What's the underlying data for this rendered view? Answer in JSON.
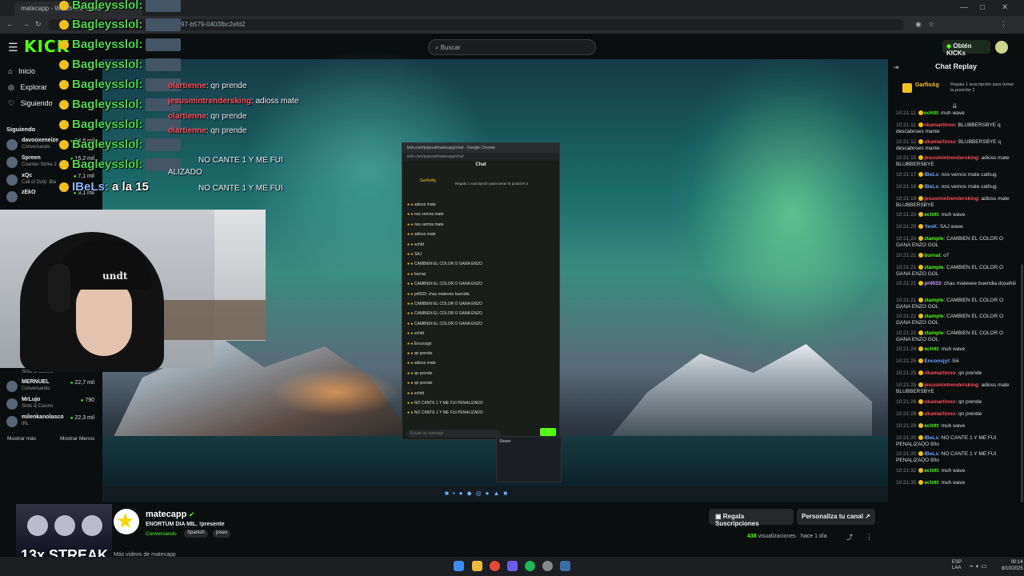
{
  "browser": {
    "tab_title": "matecapp - Watch the Video",
    "url": "7-4397-b579-0403fbc2efd2"
  },
  "header": {
    "search_placeholder": "Buscar",
    "kicks_label": "Obtén KICKs",
    "logo": "KICK"
  },
  "sidebar": {
    "nav": [
      {
        "label": "Inicio",
        "icon": "home-icon"
      },
      {
        "label": "Explorar",
        "icon": "compass-icon"
      },
      {
        "label": "Siguiendo",
        "icon": "heart-icon"
      }
    ],
    "following_header": "Siguiendo",
    "following_top": [
      {
        "name": "davooxeneize",
        "category": "Conversando",
        "viewers": "24,6 mil"
      },
      {
        "name": "Spreen",
        "category": "Counter-Strike 2",
        "viewers": "15,2 mil"
      },
      {
        "name": "xQc",
        "category": "Call of Duty: Bla",
        "viewers": "7,1 mil"
      },
      {
        "name": "zEkO",
        "category": "",
        "viewers": "3,1 mil"
      }
    ],
    "following_bottom": [
      {
        "name": "",
        "category": "Slots & Casino",
        "viewers": ""
      },
      {
        "name": "MERNUEL",
        "category": "Conversando",
        "viewers": "22,7 mil"
      },
      {
        "name": "MrLujo",
        "category": "Slots & Casino",
        "viewers": "790"
      },
      {
        "name": "milenkanolasco",
        "category": "IRL",
        "viewers": "22,3 mil"
      }
    ],
    "show_more": "Mostrar más",
    "show_less": "Mostrar Menos"
  },
  "overlay_chat": {
    "spam_user": "Bagleysslol:",
    "lines": [
      {
        "user": "olartienne",
        "text": ": qn prende"
      },
      {
        "user": "jesusmintrendersking",
        "text": ": adioss mate"
      },
      {
        "user": "olartienne",
        "text": ": qn prende"
      },
      {
        "user": "olartienne",
        "text": ": qn prende"
      },
      {
        "user": "",
        "text": "NO CANTE 1 Y ME FUI"
      },
      {
        "user": "",
        "text": "NO CANTE 1 Y ME FUI"
      }
    ],
    "penalizado": "ALIZADO",
    "ibels": "IBeLs:",
    "ibels_text": "a la 15"
  },
  "popout": {
    "title": "kick.com/popout/matecapp/chat - Google Chrome",
    "url": "kick.com/popout/matecapp/chat",
    "header": "Chat",
    "pinned_user": "GarfioAg",
    "pinned_text": "Regala 1 suscripción para tomar la posición 2",
    "lines": [
      "adioss mate",
      "nos vemos mate",
      "nos vemos mate",
      "adioss mate",
      "echttt",
      "SAJ",
      "CAMBIEN EL COLOR O GANA ENZO",
      "burnat",
      "CAMBIEN EL COLOR O GANA ENZO",
      "pril033: chau mateeee buendia",
      "CAMBIEN EL COLOR O GANA ENZO",
      "CAMBIEN EL COLOR O GANA ENZO",
      "CAMBIEN EL COLOR O GANA ENZO",
      "echttt",
      "Encoosjyt",
      "qn prende",
      "adioss mate",
      "qn prende",
      "qn prende",
      "echttt",
      "NO CANTE 1 Y ME FUI PENALIZADO",
      "NO CANTE 1 Y ME FUI PENALIZADO"
    ],
    "input_placeholder": "Enviar un mensaje",
    "steam_label": "Steam"
  },
  "chat_panel": {
    "title": "Chat Replay",
    "pinned_user": "GarfioAg",
    "pinned_text": "Regala 1 suscripción para tomar la posición 2",
    "messages": [
      {
        "time": "10:21:11",
        "user": "echttt",
        "color": "#53fc18",
        "text": ": muh wave"
      },
      {
        "time": "10:21:11",
        "user": "okamartinno",
        "color": "#ff4d5a",
        "text": ": BLUBBERSBYE q descabnses mante"
      },
      {
        "time": "10:21:12",
        "user": "okamartinno",
        "color": "#ff4d5a",
        "text": ": BLUBBERSBYE q descabnses mante"
      },
      {
        "time": "10:21:15",
        "user": "jesusmintrendersking",
        "color": "#ff4d5a",
        "text": ": adioss mate BLUBBERSBYE"
      },
      {
        "time": "10:21:17",
        "user": "IBeLs",
        "color": "#6aa5ff",
        "text": ": nos vemos mate cathug"
      },
      {
        "time": "10:21:18",
        "user": "IBeLs",
        "color": "#6aa5ff",
        "text": ": nos vemos mate cathug"
      },
      {
        "time": "10:21:19",
        "user": "jesusmintrendersking",
        "color": "#ff4d5a",
        "text": ": adioss mate BLUBBERSBYE"
      },
      {
        "time": "10:21:20",
        "user": "echttt",
        "color": "#53fc18",
        "text": ": muh wave"
      },
      {
        "time": "10:21:20",
        "user": "YesK",
        "color": "#6aa5ff",
        "text": ": SAJ wave"
      },
      {
        "time": "10:21:20",
        "user": "ztample",
        "color": "#53fc18",
        "text": ": CAMBIEN EL COLOR O GANA ENZO GOL"
      },
      {
        "time": "10:21:21",
        "user": "burnat",
        "color": "#53fc18",
        "text": ": o7"
      },
      {
        "time": "10:21:21",
        "user": "ztample",
        "color": "#53fc18",
        "text": ": CAMBIEN EL COLOR O GANA ENZO GOL"
      },
      {
        "time": "10:21:21",
        "user": "pril033",
        "color": "#c9a0ff",
        "text": ": chau mateeee buendia dosehiii"
      },
      {
        "time": "10:21:21",
        "user": "ztample",
        "color": "#53fc18",
        "text": ": CAMBIEN EL COLOR O GANA ENZO GOL"
      },
      {
        "time": "10:21:22",
        "user": "ztample",
        "color": "#53fc18",
        "text": ": CAMBIEN EL COLOR O GANA ENZO GOL"
      },
      {
        "time": "10:21:22",
        "user": "ztample",
        "color": "#53fc18",
        "text": ": CAMBIEN EL COLOR O GANA ENZO GOL"
      },
      {
        "time": "10:21:24",
        "user": "echttt",
        "color": "#53fc18",
        "text": ": muh wave"
      },
      {
        "time": "10:21:25",
        "user": "Encoosjyt",
        "color": "#6aa5ff",
        "text": ": Siii"
      },
      {
        "time": "10:21:25",
        "user": "okamartinno",
        "color": "#ff4d5a",
        "text": ": qn prende"
      },
      {
        "time": "10:21:25",
        "user": "jesusmintrendersking",
        "color": "#ff4d5a",
        "text": ": adioss mate BLUBBERSBYE"
      },
      {
        "time": "10:21:26",
        "user": "okamartinno",
        "color": "#ff4d5a",
        "text": ": qn prende"
      },
      {
        "time": "10:21:28",
        "user": "okamartinno",
        "color": "#ff4d5a",
        "text": ": qn prende"
      },
      {
        "time": "10:21:29",
        "user": "echttt",
        "color": "#53fc18",
        "text": ": muh wave"
      },
      {
        "time": "10:21:30",
        "user": "IBeLs",
        "color": "#6aa5ff",
        "text": ": NO CANTE 1 Y ME FUI PENALIZADO 90o"
      },
      {
        "time": "10:21:30",
        "user": "IBeLs",
        "color": "#6aa5ff",
        "text": ": NO CANTE 1 Y ME FUI PENALIZADO 90o"
      },
      {
        "time": "10:21:32",
        "user": "echttt",
        "color": "#53fc18",
        "text": ": muh wave"
      },
      {
        "time": "10:21:35",
        "user": "echttt",
        "color": "#53fc18",
        "text": ": muh wave"
      }
    ]
  },
  "channel": {
    "name": "matecapp",
    "title": "ENORTUM DIA MIL. !presente",
    "category": "Conversando",
    "tags": [
      "Spanish",
      "joseo"
    ],
    "streak": "13x STREAK",
    "more_videos": "Más videos de matecapp",
    "gift_label": "Regala Suscripciones",
    "customize_label": "Personaliza tu canal",
    "views_count": "438",
    "views_label": "visualizaciones",
    "posted": "hace 1 día"
  },
  "taskbar": {
    "lang1": "ESP",
    "lang2": "LAA",
    "time": "00:14",
    "date": "8/10/2025"
  }
}
